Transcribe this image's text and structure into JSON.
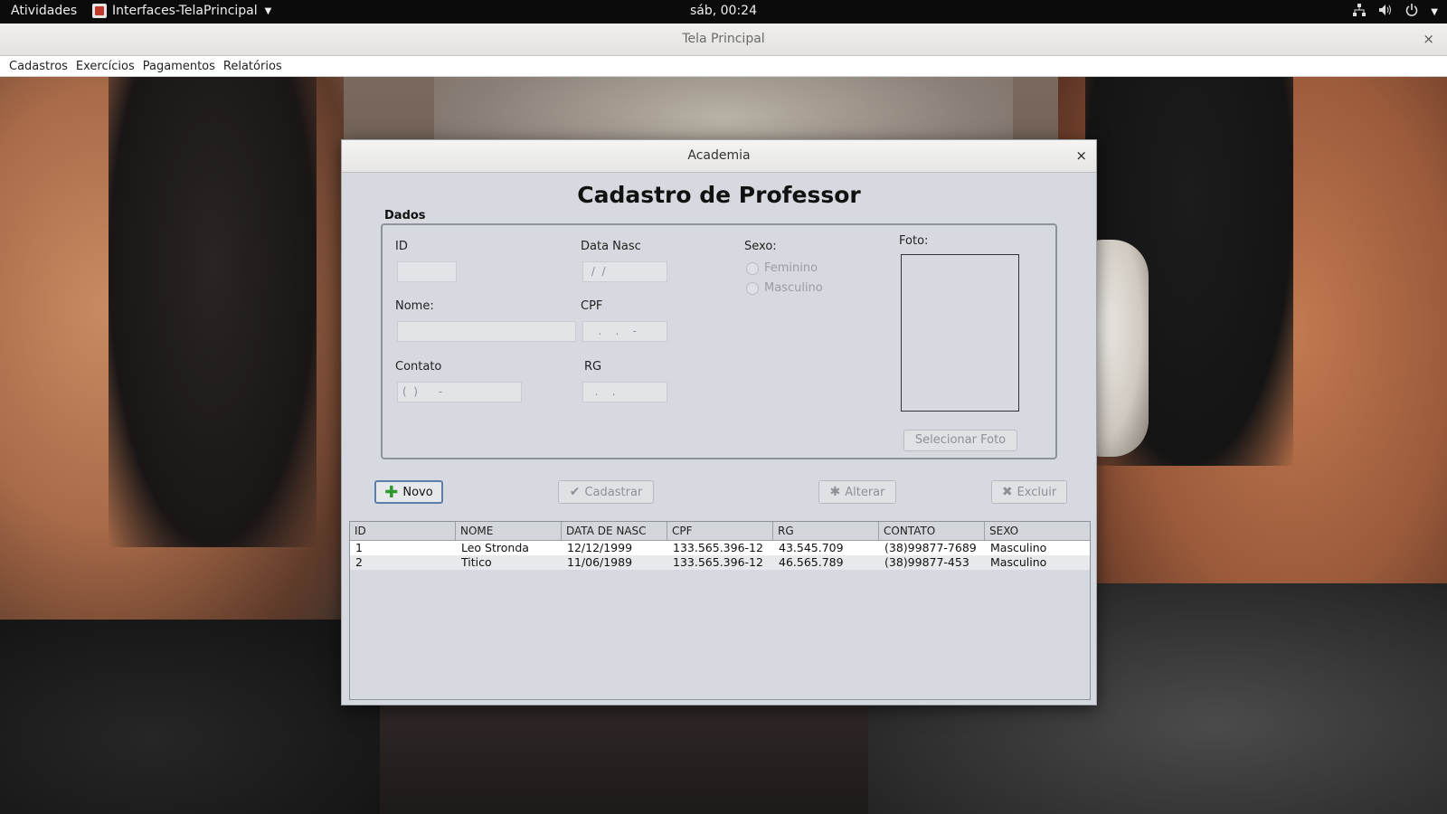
{
  "topbar": {
    "activities": "Atividades",
    "app_name": "Interfaces-TelaPrincipal",
    "clock": "sáb, 00:24",
    "tray_icons": [
      "network-icon",
      "volume-icon",
      "power-icon"
    ]
  },
  "main_window": {
    "title": "Tela Principal",
    "close_glyph": "×",
    "menus": [
      "Cadastros",
      "Exercícios",
      "Pagamentos",
      "Relatórios"
    ]
  },
  "dialog": {
    "title": "Academia",
    "close_glyph": "×",
    "heading": "Cadastro de Professor",
    "group_label": "Dados",
    "labels": {
      "id": "ID",
      "data_nasc": "Data Nasc",
      "sexo": "Sexo:",
      "foto": "Foto:",
      "nome": "Nome:",
      "cpf": "CPF",
      "contato": "Contato",
      "rg": "RG"
    },
    "fields": {
      "id": "",
      "data_nasc": " /  /",
      "nome": "",
      "cpf": "   .    .    -",
      "contato": "(  )      -",
      "rg": "  .    ."
    },
    "radios": [
      "Feminino",
      "Masculino"
    ],
    "select_photo_button": "Selecionar Foto",
    "buttons": {
      "novo": "Novo",
      "cadastrar": "Cadastrar",
      "alterar": "Alterar",
      "excluir": "Excluir"
    },
    "table": {
      "columns": [
        "ID",
        "NOME",
        "DATA DE NASC",
        "CPF",
        "RG",
        "CONTATO",
        "SEXO"
      ],
      "rows": [
        [
          "1",
          "Leo Stronda",
          "12/12/1999",
          "133.565.396-12",
          "43.545.709",
          "(38)99877-7689",
          "Masculino"
        ],
        [
          "2",
          "Titico",
          "11/06/1989",
          "133.565.396-12",
          "46.565.789",
          "(38)99877-453",
          "Masculino"
        ]
      ]
    }
  }
}
